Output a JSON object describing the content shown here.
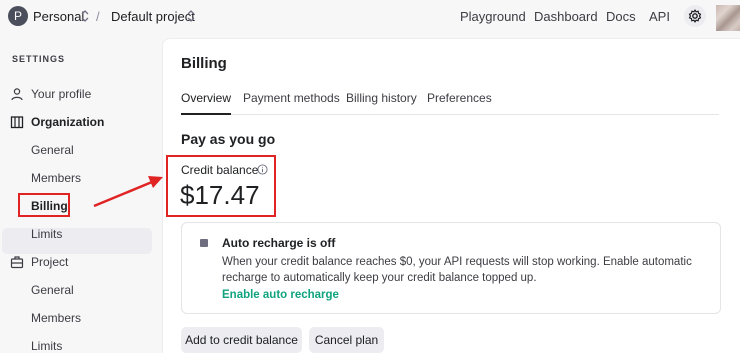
{
  "topbar": {
    "avatar_letter": "P",
    "org": "Personal",
    "separator": "/",
    "project": "Default project",
    "nav": [
      "Playground",
      "Dashboard",
      "Docs",
      "API"
    ]
  },
  "sidebar": {
    "heading": "SETTINGS",
    "items": [
      {
        "label": "Your profile",
        "icon": "user-icon"
      },
      {
        "label": "Organization",
        "icon": "building-icon"
      },
      {
        "label": "General"
      },
      {
        "label": "Members"
      },
      {
        "label": "Billing",
        "active": true
      },
      {
        "label": "Limits"
      },
      {
        "label": "Project",
        "icon": "briefcase-icon"
      },
      {
        "label": "General"
      },
      {
        "label": "Members"
      },
      {
        "label": "Limits"
      }
    ]
  },
  "main": {
    "title": "Billing",
    "tabs": [
      "Overview",
      "Payment methods",
      "Billing history",
      "Preferences"
    ],
    "active_tab": "Overview",
    "section_title": "Pay as you go",
    "credit_label": "Credit balance",
    "credit_amount": "$17.47",
    "recharge": {
      "title": "Auto recharge is off",
      "description": "When your credit balance reaches $0, your API requests will stop working. Enable automatic recharge to automatically keep your credit balance topped up.",
      "link": "Enable auto recharge"
    },
    "buttons": {
      "add_credit": "Add to credit balance",
      "cancel_plan": "Cancel plan"
    }
  },
  "colors": {
    "accent_green": "#10a37f",
    "annotation_red": "#e02424",
    "sidebar_active_bg": "#ececf1"
  }
}
